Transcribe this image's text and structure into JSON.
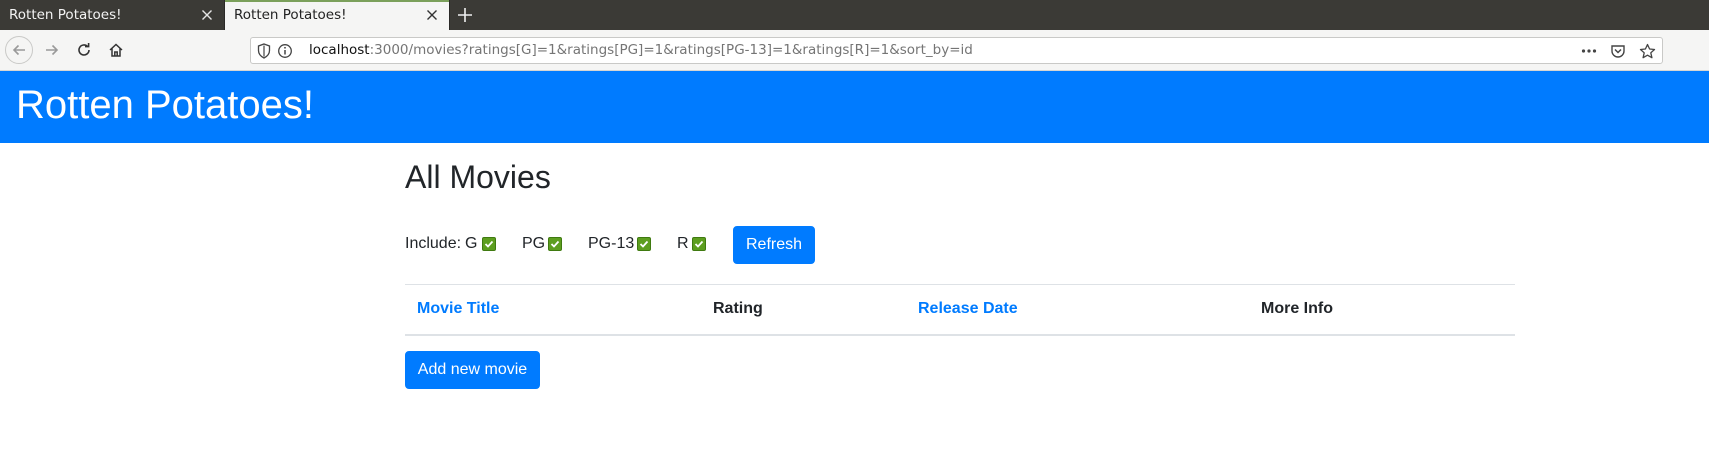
{
  "browser": {
    "tabs": [
      {
        "label": "Rotten Potatoes!",
        "active": false
      },
      {
        "label": "Rotten Potatoes!",
        "active": true
      }
    ],
    "url": {
      "host": "localhost",
      "rest": ":3000/movies?ratings[G]=1&ratings[PG]=1&ratings[PG-13]=1&ratings[R]=1&sort_by=id"
    },
    "icons": {
      "back": "back-arrow-icon",
      "forward": "forward-arrow-icon",
      "reload": "reload-icon",
      "home": "home-icon",
      "shield": "tracking-shield-icon",
      "info": "info-icon",
      "more": "more-actions-icon",
      "pocket": "pocket-icon",
      "bookmark": "bookmark-star-icon"
    }
  },
  "app": {
    "title": "Rotten Potatoes!",
    "brand_color": "#007bff"
  },
  "main": {
    "page_title": "All Movies",
    "filters": {
      "include_label": "Include:",
      "ratings": [
        {
          "label": "G",
          "checked": true
        },
        {
          "label": "PG",
          "checked": true
        },
        {
          "label": "PG-13",
          "checked": true
        },
        {
          "label": "R",
          "checked": true
        }
      ],
      "refresh_label": "Refresh"
    },
    "table": {
      "headers": [
        {
          "label": "Movie Title",
          "link": true
        },
        {
          "label": "Rating",
          "link": false
        },
        {
          "label": "Release Date",
          "link": true
        },
        {
          "label": "More Info",
          "link": false
        }
      ],
      "rows": []
    },
    "add_label": "Add new movie"
  }
}
